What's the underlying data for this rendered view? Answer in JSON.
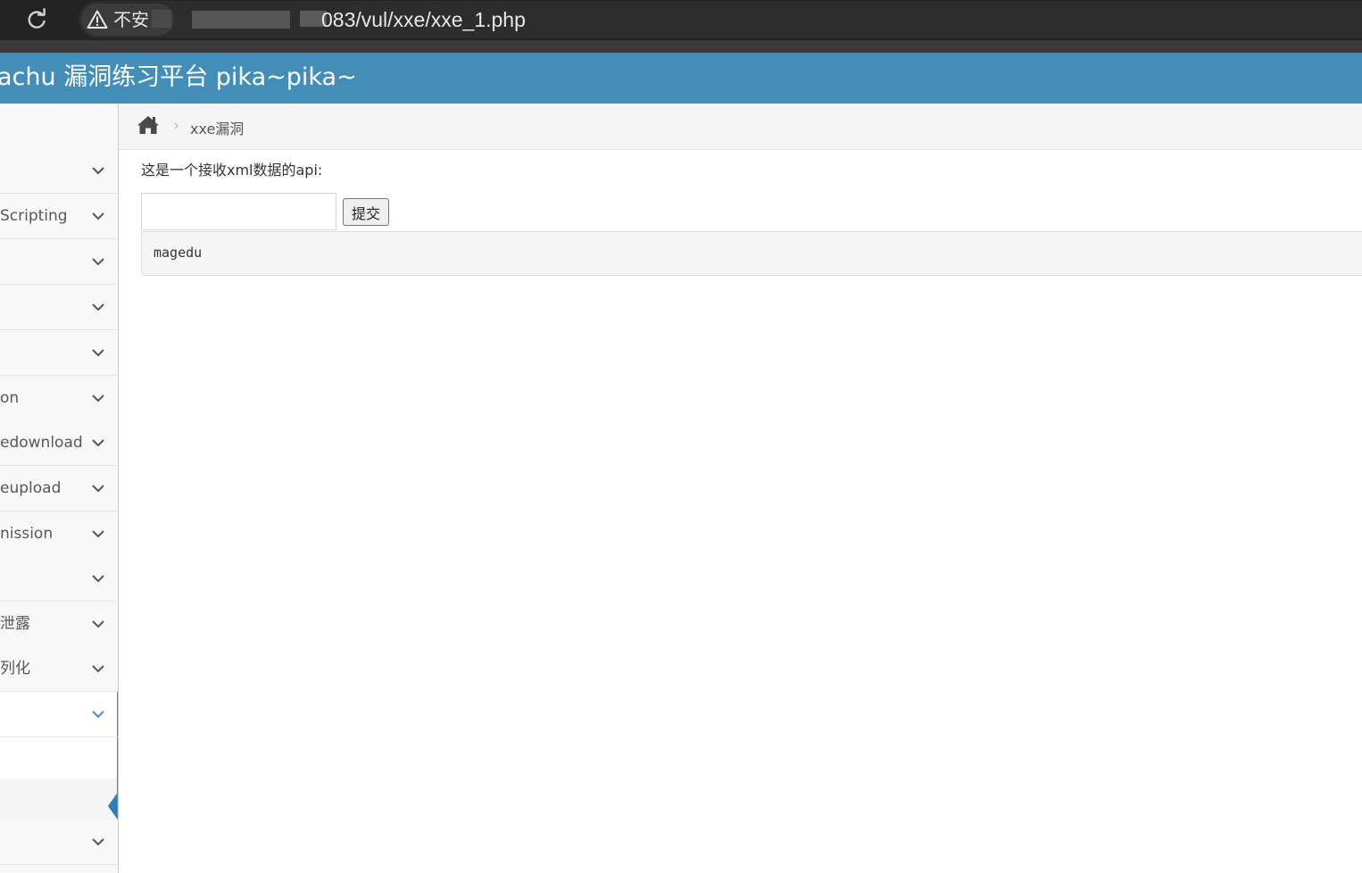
{
  "browser": {
    "security_label": "不安",
    "url_visible": "083/vul/xxe/xxe_1.php",
    "icons": {
      "reload": "reload-icon",
      "warning": "warning-icon"
    }
  },
  "app": {
    "title": "achu 漏洞练习平台 pika~pika~",
    "header_color": "#438eb9"
  },
  "sidebar": {
    "items": [
      {
        "label": ""
      },
      {
        "label": "Scripting"
      },
      {
        "label": ""
      },
      {
        "label": ""
      },
      {
        "label": ""
      },
      {
        "label": "on"
      },
      {
        "label": "edownload"
      },
      {
        "label": "eupload"
      },
      {
        "label": "nission"
      },
      {
        "label": ""
      },
      {
        "label": "泄露"
      },
      {
        "label": "列化"
      },
      {
        "label": "",
        "expanded": true
      }
    ],
    "submenu": [
      {
        "label": "",
        "active": false
      },
      {
        "label": "",
        "active": true
      }
    ],
    "after_items": [
      {
        "label": ""
      }
    ],
    "accent_color": "#2b7dbc"
  },
  "breadcrumb": {
    "home_icon": "home-icon",
    "separator": "›",
    "current": "xxe漏洞"
  },
  "main": {
    "api_label": "这是一个接收xml数据的api:",
    "input": {
      "value": "",
      "placeholder": ""
    },
    "submit_label": "提交",
    "result": "magedu"
  }
}
